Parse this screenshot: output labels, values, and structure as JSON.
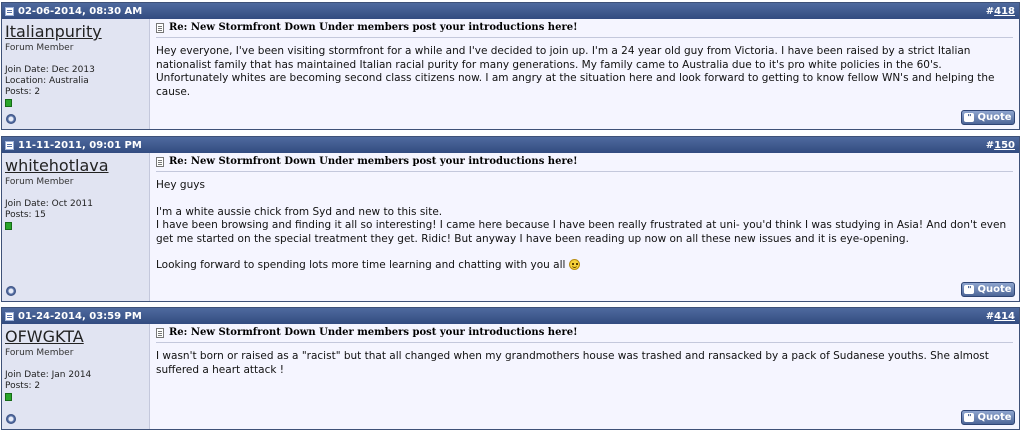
{
  "posts": [
    {
      "date": "02-06-2014, 08:30 AM",
      "number": "418",
      "username": "Italianpurity",
      "usertitle": "Forum Member",
      "join_date": "Join Date: Dec 2013",
      "location": "Location: Australia",
      "posts_count": "Posts: 2",
      "title": "Re: New Stormfront Down Under members post your introductions here!",
      "message": "Hey everyone, I've been visiting stormfront for a while and I've decided to join up. I'm a 24 year old guy from Victoria. I have been raised by a strict Italian nationalist family that has maintained Italian racial purity for many generations. My family came to Australia due to it's pro white policies in the 60's. Unfortunately whites are becoming second class citizens now. I am angry at the situation here and look forward to getting to know fellow WN's and helping the cause.",
      "quote_label": "Quote"
    },
    {
      "date": "11-11-2011, 09:01 PM",
      "number": "150",
      "username": "whitehotlava",
      "usertitle": "Forum Member",
      "join_date": "Join Date: Oct 2011",
      "posts_count": "Posts: 15",
      "title": "Re: New Stormfront Down Under members post your introductions here!",
      "message_line1": "Hey guys",
      "message_line2": "I'm a white aussie chick from Syd and new to this site.\nI have been browsing and finding it all so interesting! I came here because I have been really frustrated at uni- you'd think I was studying in Asia! And don't even get me started on the special treatment they get. Ridic! But anyway I have been reading up now on all these new issues and it is eye-opening.",
      "message_line3": "Looking forward to spending lots more time learning and chatting with you all ",
      "quote_label": "Quote"
    },
    {
      "date": "01-24-2014, 03:59 PM",
      "number": "414",
      "username": "OFWGKTA",
      "usertitle": "Forum Member",
      "join_date": "Join Date: Jan 2014",
      "posts_count": "Posts: 2",
      "title": "Re: New Stormfront Down Under members post your introductions here!",
      "message": "I wasn't born or raised as a \"racist\" but that all changed when my grandmothers house was trashed and ransacked by a pack of Sudanese youths. She almost suffered a heart attack !",
      "quote_label": "Quote"
    }
  ]
}
